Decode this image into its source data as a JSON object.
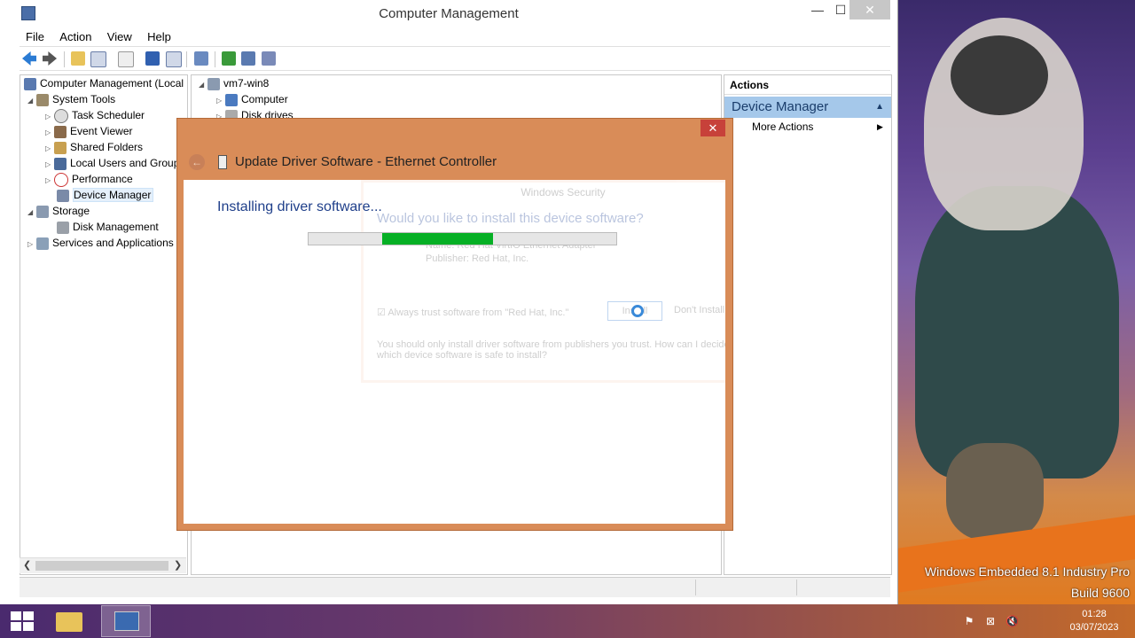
{
  "wallpaper": {
    "os_name": "Windows Embedded 8.1 Industry Pro",
    "build": "Build 9600"
  },
  "window": {
    "title": "Computer Management",
    "min": "—",
    "max": "☐",
    "close": "✕"
  },
  "menu": [
    "File",
    "Action",
    "View",
    "Help"
  ],
  "tree": {
    "root": "Computer Management (Local",
    "system_tools": "System Tools",
    "task_scheduler": "Task Scheduler",
    "event_viewer": "Event Viewer",
    "shared_folders": "Shared Folders",
    "local_users": "Local Users and Groups",
    "performance": "Performance",
    "device_manager": "Device Manager",
    "storage": "Storage",
    "disk_management": "Disk Management",
    "services": "Services and Applications"
  },
  "devices": {
    "root": "vm7-win8",
    "computer": "Computer",
    "disk_drives": "Disk drives"
  },
  "actions": {
    "header": "Actions",
    "section": "Device Manager",
    "more": "More Actions"
  },
  "dialog": {
    "close": "✕",
    "back": "←",
    "title": "Update Driver Software - Ethernet Controller",
    "heading": "Installing driver software...",
    "progress_start": 0.24,
    "progress_end": 0.6
  },
  "ghost": {
    "title": "Windows Security",
    "question": "Would you like to install this device software?",
    "name": "Name: Red Hat VirtIO Ethernet Adapter",
    "publisher": "Publisher: Red Hat, Inc.",
    "checkbox": "Always trust software from \"Red Hat, Inc.\"",
    "install": "Install",
    "dont_install": "Don't Install",
    "warning": "You should only install driver software from publishers you trust. How can I decide which device software is safe to install?"
  },
  "taskbar": {
    "time": "01:28",
    "date": "03/07/2023"
  },
  "colors": {
    "dialog_frame": "#d98c58",
    "progress_green": "#06b025",
    "selection": "#a5c8ea"
  }
}
